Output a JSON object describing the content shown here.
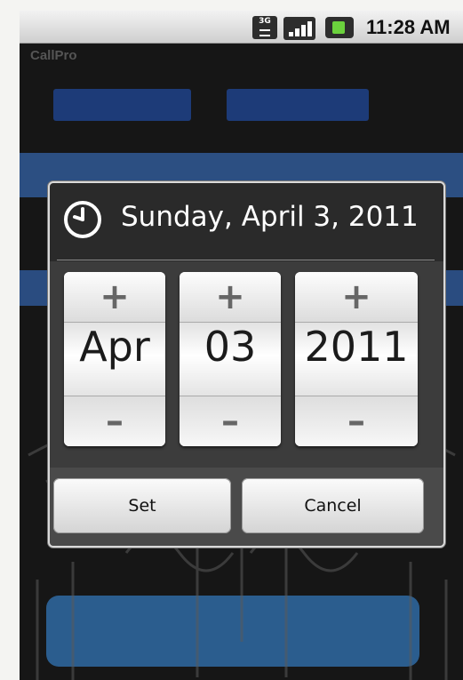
{
  "status_bar": {
    "network_type": "3G",
    "time": "11:28 AM",
    "icons": [
      "3g-icon",
      "signal-icon",
      "battery-icon"
    ]
  },
  "app": {
    "title": "CallPro"
  },
  "dialog": {
    "title": "Sunday, April 3, 2011",
    "icon": "clock-icon",
    "pickers": [
      {
        "name": "month",
        "value": "Apr",
        "increment": "+",
        "decrement": "–"
      },
      {
        "name": "day",
        "value": "03",
        "increment": "+",
        "decrement": "–"
      },
      {
        "name": "year",
        "value": "2011",
        "increment": "+",
        "decrement": "–"
      }
    ],
    "buttons": {
      "set": "Set",
      "cancel": "Cancel"
    }
  },
  "colors": {
    "dialog_background": "#3c3c3c",
    "background_button": "#1d3b78",
    "battery_accent": "#6bd13d"
  }
}
